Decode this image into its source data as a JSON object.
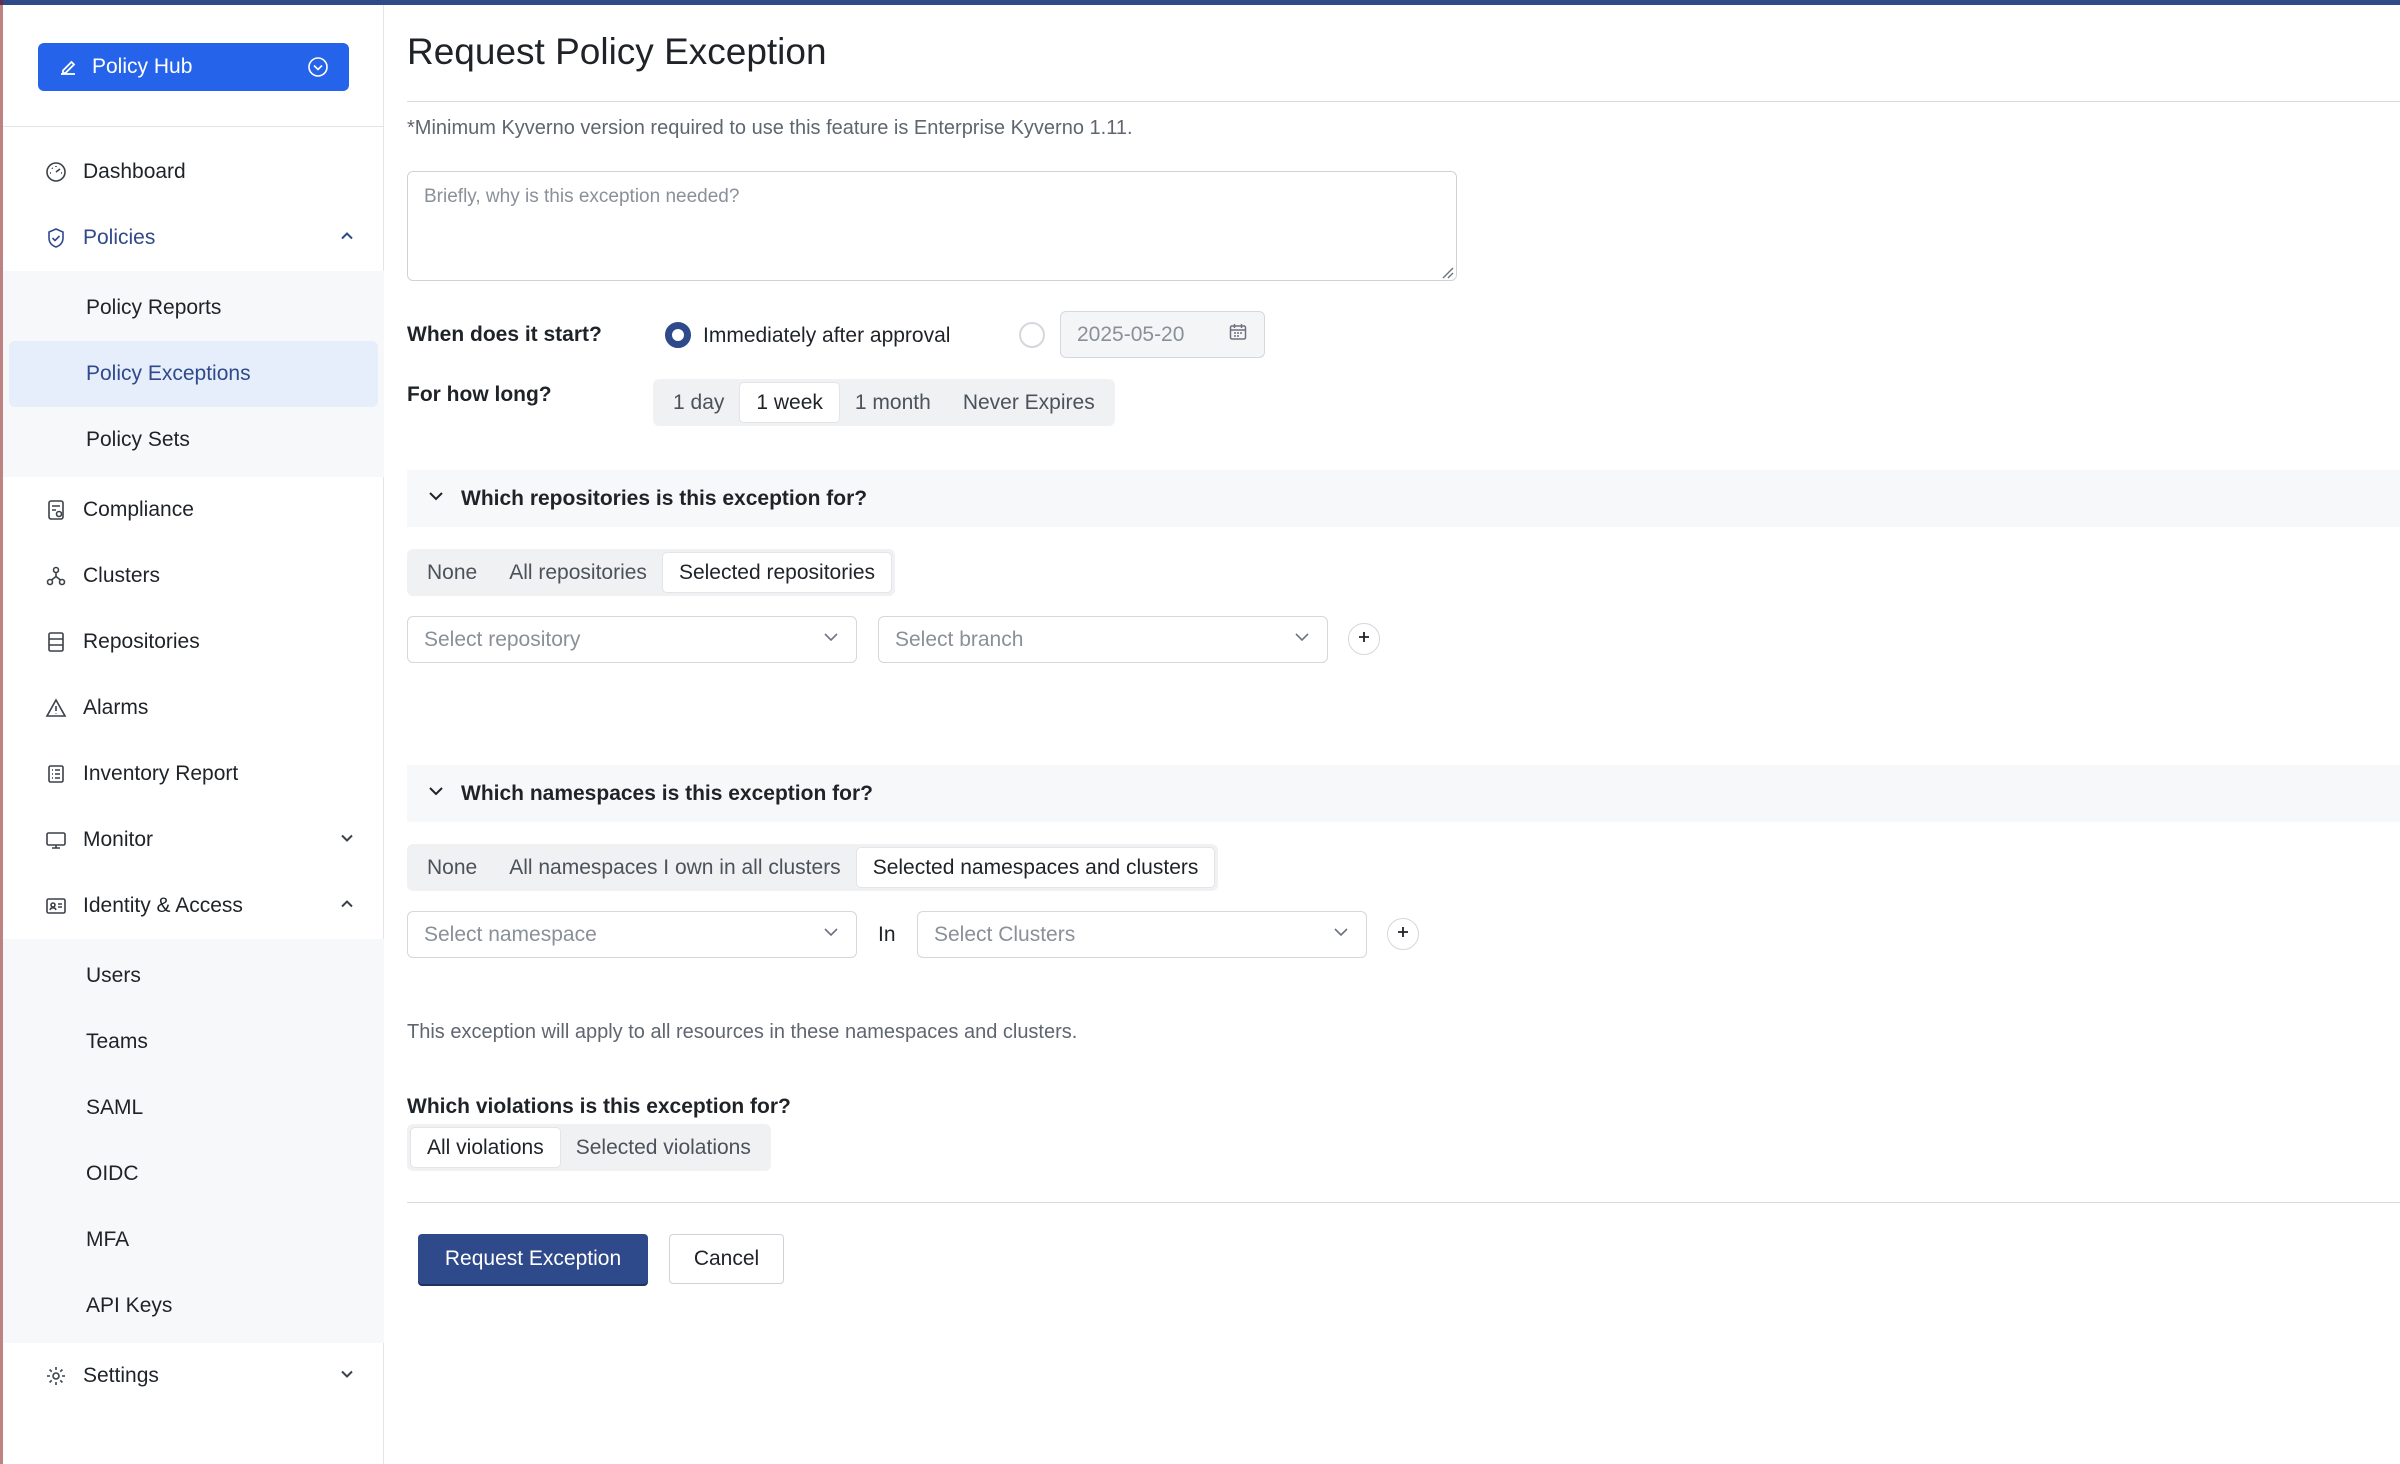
{
  "sidebar": {
    "hub_button": "Policy Hub",
    "nav": {
      "dashboard": "Dashboard",
      "policies": "Policies",
      "policy_reports": "Policy Reports",
      "policy_exceptions": "Policy Exceptions",
      "policy_sets": "Policy Sets",
      "compliance": "Compliance",
      "clusters": "Clusters",
      "repositories": "Repositories",
      "alarms": "Alarms",
      "inventory_report": "Inventory Report",
      "monitor": "Monitor",
      "identity_access": "Identity & Access",
      "users": "Users",
      "teams": "Teams",
      "saml": "SAML",
      "oidc": "OIDC",
      "mfa": "MFA",
      "api_keys": "API Keys",
      "settings": "Settings"
    },
    "selected_item": "Policy Exceptions"
  },
  "page": {
    "title": "Request Policy Exception",
    "note": "*Minimum Kyverno version required to use this feature is Enterprise Kyverno 1.11.",
    "reason_placeholder": "Briefly, why is this exception needed?",
    "start": {
      "label": "When does it start?",
      "option_immediate": "Immediately after approval",
      "date_value": "2025-05-20",
      "selected": "immediate"
    },
    "duration": {
      "label": "For how long?",
      "options": [
        "1 day",
        "1 week",
        "1 month",
        "Never Expires"
      ],
      "selected": "1 week"
    },
    "repositories": {
      "heading": "Which repositories is this exception for?",
      "options": [
        "None",
        "All repositories",
        "Selected repositories"
      ],
      "selected": "Selected repositories",
      "repo_placeholder": "Select repository",
      "branch_placeholder": "Select branch"
    },
    "namespaces": {
      "heading": "Which namespaces is this exception for?",
      "options": [
        "None",
        "All namespaces I own in all clusters",
        "Selected namespaces and clusters"
      ],
      "selected": "Selected namespaces and clusters",
      "namespace_placeholder": "Select namespace",
      "in_label": "In",
      "clusters_placeholder": "Select Clusters",
      "helper": "This exception will apply to all resources in these namespaces and clusters."
    },
    "violations": {
      "label": "Which violations is this exception for?",
      "options": [
        "All violations",
        "Selected violations"
      ],
      "selected": "All violations"
    },
    "actions": {
      "submit": "Request Exception",
      "cancel": "Cancel"
    }
  },
  "colors": {
    "accent": "#2f4a8a",
    "hub_button": "#2563eb",
    "selected_nav_bg": "#e6eefb"
  }
}
